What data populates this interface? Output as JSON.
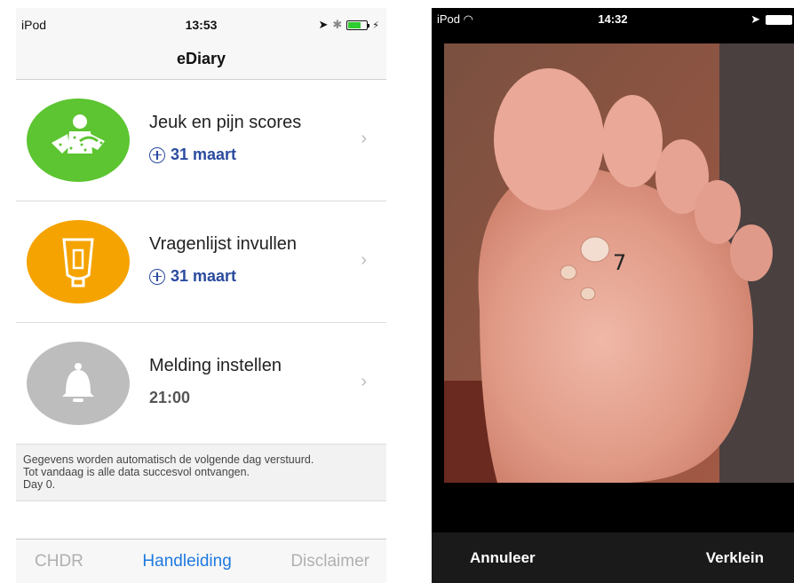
{
  "left": {
    "status": {
      "carrier": "iPod",
      "time": "13:53"
    },
    "nav": {
      "title": "eDiary"
    },
    "rows": [
      {
        "label": "Jeuk en pijn scores",
        "sub": "31 maart",
        "color": "#5cc531"
      },
      {
        "label": "Vragenlijst invullen",
        "sub": "31 maart",
        "color": "#f5a300"
      },
      {
        "label": "Melding instellen",
        "sub": "21:00",
        "color": "#bdbdbd"
      }
    ],
    "info": {
      "line1": "Gegevens worden automatisch de volgende dag verstuurd.",
      "line2": "Tot vandaag is alle data succesvol ontvangen.",
      "line3": "Day 0."
    },
    "tabs": [
      {
        "label": "CHDR"
      },
      {
        "label": "Handleiding"
      },
      {
        "label": "Disclaimer"
      }
    ],
    "colors": {
      "accent": "#1e7ae0",
      "link": "#2a4b9e"
    }
  },
  "right": {
    "status": {
      "carrier": "iPod",
      "time": "14:32"
    },
    "photo": {
      "annotation": "7"
    },
    "buttons": {
      "cancel": "Annuleer",
      "zoom_out": "Verklein"
    }
  }
}
